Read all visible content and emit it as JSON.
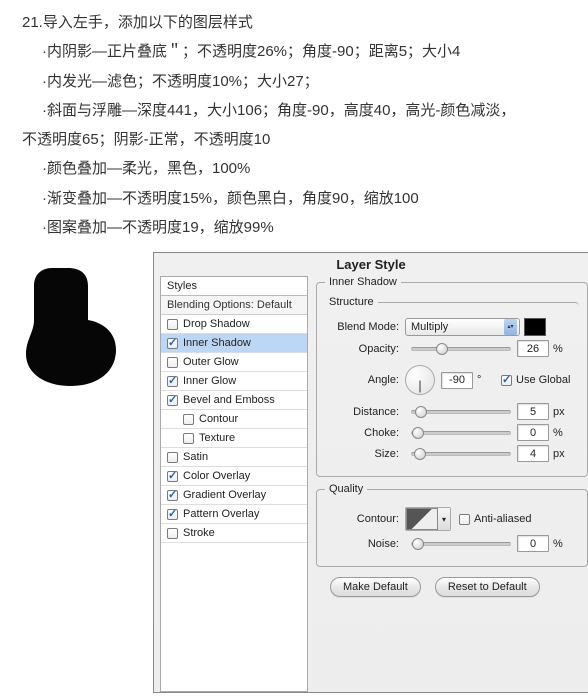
{
  "instructions": {
    "line0": "21.导入左手，添加以下的图层样式",
    "line1": "·内阴影―正片叠底＂；不透明度26%；角度-90；距离5；大小4",
    "line2": "·内发光―滤色；不透明度10%；大小27；",
    "line3": "·斜面与浮雕―深度441，大小106；角度-90，高度40，高光-颜色减淡，",
    "line4": "不透明度65；阴影-正常，不透明度10",
    "line5": "·颜色叠加―柔光，黑色，100%",
    "line6": "·渐变叠加―不透明度15%，颜色黑白，角度90，缩放100",
    "line7": "·图案叠加―不透明度19，缩放99%"
  },
  "dialog": {
    "title": "Layer Style",
    "stylesHeader": "Styles",
    "blendingDefault": "Blending Options: Default",
    "items": [
      {
        "label": "Drop Shadow",
        "checked": false,
        "sub": false,
        "selected": false
      },
      {
        "label": "Inner Shadow",
        "checked": true,
        "sub": false,
        "selected": true
      },
      {
        "label": "Outer Glow",
        "checked": false,
        "sub": false,
        "selected": false
      },
      {
        "label": "Inner Glow",
        "checked": true,
        "sub": false,
        "selected": false
      },
      {
        "label": "Bevel and Emboss",
        "checked": true,
        "sub": false,
        "selected": false
      },
      {
        "label": "Contour",
        "checked": false,
        "sub": true,
        "selected": false
      },
      {
        "label": "Texture",
        "checked": false,
        "sub": true,
        "selected": false
      },
      {
        "label": "Satin",
        "checked": false,
        "sub": false,
        "selected": false
      },
      {
        "label": "Color Overlay",
        "checked": true,
        "sub": false,
        "selected": false
      },
      {
        "label": "Gradient Overlay",
        "checked": true,
        "sub": false,
        "selected": false
      },
      {
        "label": "Pattern Overlay",
        "checked": true,
        "sub": false,
        "selected": false
      },
      {
        "label": "Stroke",
        "checked": false,
        "sub": false,
        "selected": false
      }
    ],
    "innerShadow": {
      "groupTitle": "Inner Shadow",
      "structureTitle": "Structure",
      "blendModeLabel": "Blend Mode:",
      "blendModeValue": "Multiply",
      "colorValue": "#000000",
      "opacityLabel": "Opacity:",
      "opacityValue": "26",
      "opacityUnit": "%",
      "angleLabel": "Angle:",
      "angleValue": "-90",
      "angleUnit": "°",
      "useGlobalLabel": "Use Global",
      "useGlobalChecked": true,
      "distanceLabel": "Distance:",
      "distanceValue": "5",
      "distanceUnit": "px",
      "chokeLabel": "Choke:",
      "chokeValue": "0",
      "chokeUnit": "%",
      "sizeLabel": "Size:",
      "sizeValue": "4",
      "sizeUnit": "px"
    },
    "quality": {
      "title": "Quality",
      "contourLabel": "Contour:",
      "antiAliasedLabel": "Anti-aliased",
      "antiAliasedChecked": false,
      "noiseLabel": "Noise:",
      "noiseValue": "0",
      "noiseUnit": "%"
    },
    "buttons": {
      "makeDefault": "Make Default",
      "resetDefault": "Reset to Default"
    }
  }
}
